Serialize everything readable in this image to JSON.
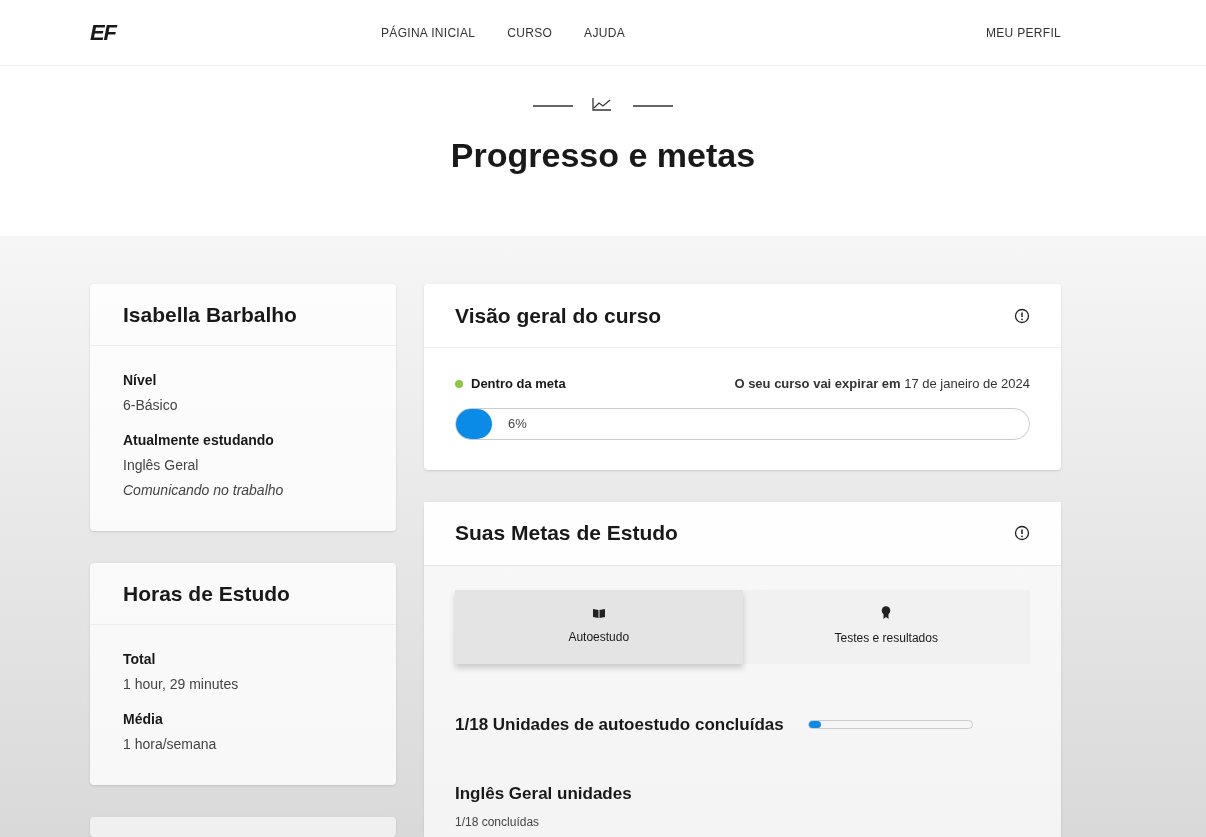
{
  "header": {
    "logo": "EF",
    "nav": [
      {
        "label": "PÁGINA INICIAL"
      },
      {
        "label": "CURSO"
      },
      {
        "label": "AJUDA"
      }
    ],
    "profile": "MEU PERFIL"
  },
  "title": "Progresso e metas",
  "profile_card": {
    "name": "Isabella Barbalho",
    "fields": [
      {
        "label": "Nível",
        "lines": [
          "6-Básico"
        ]
      },
      {
        "label": "Atualmente estudando",
        "lines": [
          "Inglês Geral"
        ],
        "italic_line": "Comunicando no trabalho"
      }
    ]
  },
  "hours_card": {
    "title": "Horas de Estudo",
    "fields": [
      {
        "label": "Total",
        "lines": [
          "1 hour, 29 minutes"
        ]
      },
      {
        "label": "Média",
        "lines": [
          "1 hora/semana"
        ]
      }
    ]
  },
  "overview": {
    "title": "Visão geral do curso",
    "status": {
      "label": "Dentro da meta",
      "color": "#8dc63f"
    },
    "expiry": "**O seu curso vai expirar em** 17 de janeiro de 2024",
    "progress": {
      "level": 0.06,
      "reading": "6%"
    }
  },
  "goals": {
    "title": "Suas Metas de Estudo",
    "tabs": [
      {
        "label": "Autoestudo",
        "kind": "book",
        "selected": true
      },
      {
        "label": "Testes e resultados",
        "kind": "award",
        "selected": false
      }
    ],
    "summary": {
      "text": "1/18 Unidades de autoestudo concluídas",
      "level": 0.06
    },
    "section": {
      "title": "Inglês Geral unidades",
      "subtitle": "1/18 concluídas"
    }
  }
}
